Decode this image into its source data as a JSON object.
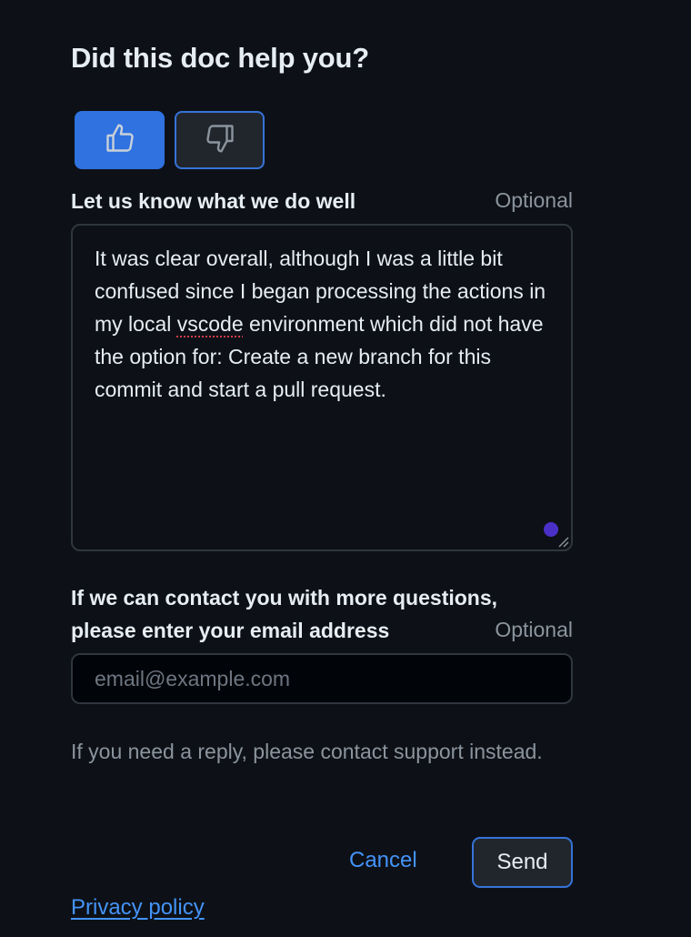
{
  "feedback": {
    "title": "Did this doc help you?",
    "vote": {
      "selected": "thumbs-up",
      "up_icon": "thumbs-up-icon",
      "down_icon": "thumbs-down-icon"
    },
    "comment": {
      "label": "Let us know what we do well",
      "optional": "Optional",
      "value_before": "It was clear overall, although I was a little bit confused since I began processing the actions in my local ",
      "value_misspelled": "vscode",
      "value_after": " environment which did not have the option for: Create a new branch for this commit and start a pull request."
    },
    "email": {
      "label": "If we can contact you with more questions, please enter your email address",
      "optional": "Optional",
      "placeholder": "email@example.com",
      "value": ""
    },
    "note": "If you need a reply, please contact support instead.",
    "actions": {
      "cancel": "Cancel",
      "send": "Send"
    },
    "privacy_link": "Privacy policy"
  },
  "colors": {
    "background": "#0d1117",
    "accent": "#2f72e0",
    "link": "#4493f8",
    "muted": "#8b949e",
    "text": "#e6edf3"
  }
}
